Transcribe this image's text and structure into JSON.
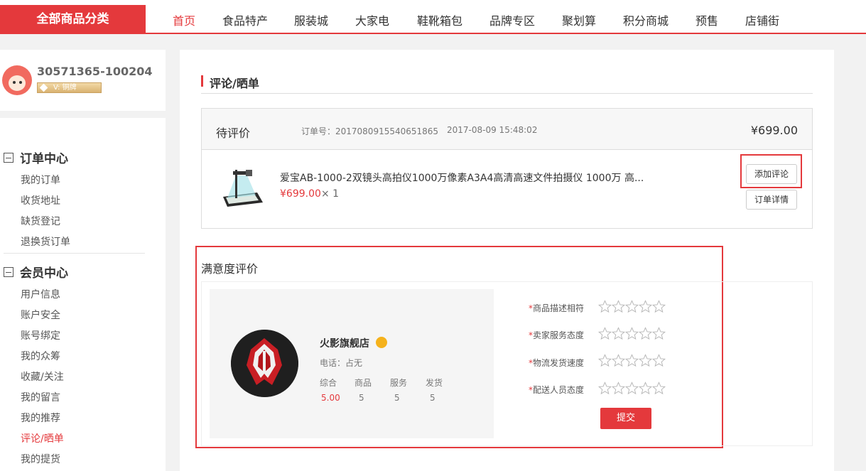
{
  "header": {
    "all_categories": "全部商品分类",
    "nav": [
      "首页",
      "食品特产",
      "服装城",
      "大家电",
      "鞋靴箱包",
      "品牌专区",
      "聚划算",
      "积分商城",
      "预售",
      "店铺街"
    ],
    "active_index": 0
  },
  "user": {
    "id": "30571365-100204",
    "level": "V: 铜牌"
  },
  "sidebar": {
    "groups": [
      {
        "title": "订单中心",
        "items": [
          "我的订单",
          "收货地址",
          "缺货登记",
          "退换货订单"
        ]
      },
      {
        "title": "会员中心",
        "items": [
          "用户信息",
          "账户安全",
          "账号绑定",
          "我的众筹",
          "收藏/关注",
          "我的留言",
          "我的推荐",
          "评论/晒单",
          "我的提货"
        ]
      }
    ],
    "active_item": "评论/晒单"
  },
  "main": {
    "section_title": "评论/晒单",
    "order": {
      "status": "待评价",
      "order_no": "订单号：2017080915540651865",
      "time": "2017-08-09 15:48:02",
      "total": "¥699.00",
      "product_name": "爱宝AB-1000-2双镜头高拍仪1000万像素A3A4高清高速文件拍摄仪 1000万 高...",
      "product_price": "¥699.00",
      "product_qty": "× 1",
      "add_review_label": "添加评论",
      "order_detail_label": "订单详情"
    },
    "satisfaction": {
      "title": "满意度评价",
      "shop": {
        "name": "火影旗舰店",
        "phone": "电话：占无",
        "scores": [
          {
            "label": "综合",
            "value": "5.00"
          },
          {
            "label": "商品",
            "value": "5"
          },
          {
            "label": "服务",
            "value": "5"
          },
          {
            "label": "发货",
            "value": "5"
          }
        ]
      },
      "ratings": [
        {
          "label": "商品描述相符",
          "stars": 0
        },
        {
          "label": "卖家服务态度",
          "stars": 0
        },
        {
          "label": "物流发货速度",
          "stars": 0
        },
        {
          "label": "配送人员态度",
          "stars": 0
        }
      ],
      "required_mark": "*",
      "submit_label": "提交"
    }
  },
  "colors": {
    "accent": "#e4393c"
  }
}
